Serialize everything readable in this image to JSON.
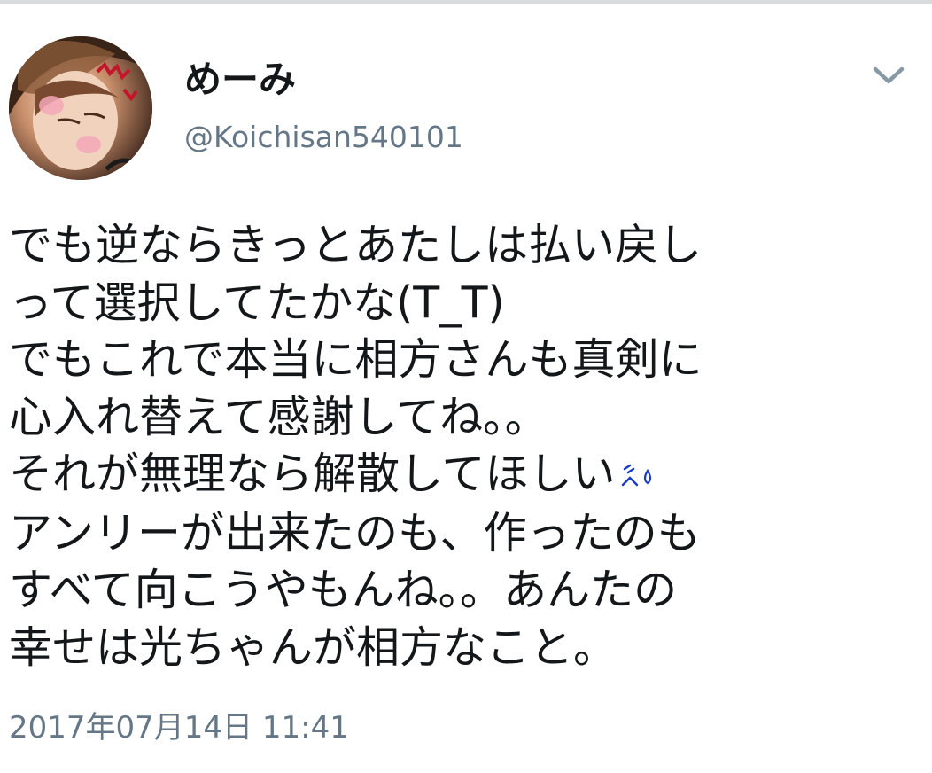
{
  "tweet": {
    "author": {
      "display_name": "めーみ",
      "handle": "@Koichisan540101",
      "avatar": "user-avatar-photo"
    },
    "menu_icon": "chevron-down-icon",
    "body_lines": [
      "でも逆ならきっとあたしは払い戻し",
      "って選択してたかな(T_T)",
      "でもこれで本当に相方さんも真剣に",
      "心入れ替えて感謝してね。。",
      "それが無理なら解散してほしい",
      "アンリーが出来たのも、作ったのも",
      "すべて向こうやもんね。。あんたの",
      "幸せは光ちゃんが相方なこと。"
    ],
    "inline_emoji": "sweat-emoji-icon",
    "timestamp": "2017年07月14日 11:41"
  },
  "colors": {
    "text_primary": "#14171a",
    "text_secondary": "#657786",
    "chevron": "#8899a6",
    "divider": "#d9dcdf",
    "emoji_blue": "#1a3cc8"
  }
}
